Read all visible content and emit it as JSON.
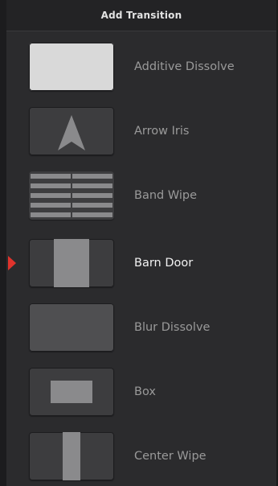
{
  "panel": {
    "title": "Add Transition",
    "selected_index": 3,
    "items": [
      {
        "label": "Additive Dissolve",
        "icon": "additive-dissolve-thumbnail"
      },
      {
        "label": "Arrow Iris",
        "icon": "arrow-iris-thumbnail"
      },
      {
        "label": "Band Wipe",
        "icon": "band-wipe-thumbnail"
      },
      {
        "label": "Barn Door",
        "icon": "barn-door-thumbnail"
      },
      {
        "label": "Blur Dissolve",
        "icon": "blur-dissolve-thumbnail"
      },
      {
        "label": "Box",
        "icon": "box-thumbnail"
      },
      {
        "label": "Center Wipe",
        "icon": "center-wipe-thumbnail"
      }
    ]
  },
  "colors": {
    "accent_marker": "#e0332c",
    "label_default": "#9a9a9a",
    "label_selected": "#f2f2f2"
  }
}
